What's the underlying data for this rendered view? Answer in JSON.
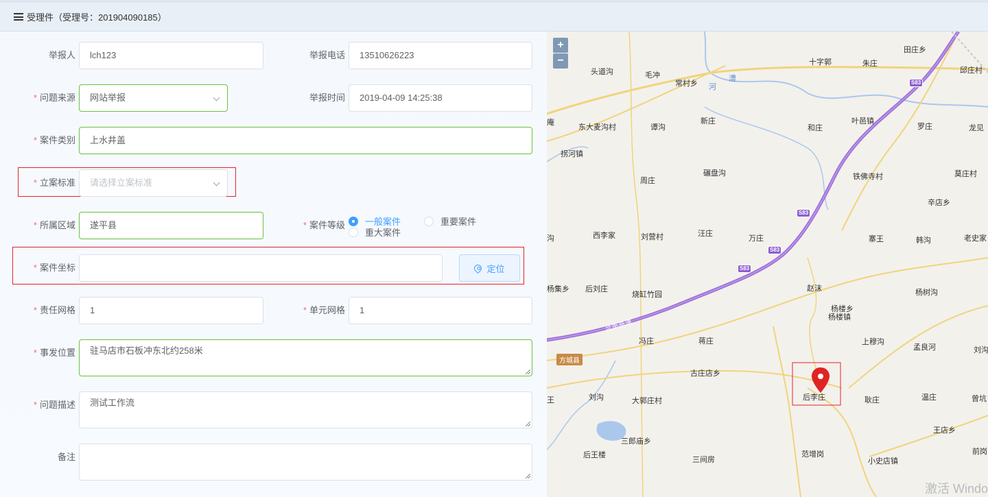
{
  "header": {
    "title": "受理件（受理号：201904090185）"
  },
  "form": {
    "reporter": {
      "label": "举报人",
      "value": "lch123"
    },
    "phone": {
      "label": "举报电话",
      "value": "13510626223"
    },
    "source": {
      "label": "问题来源",
      "value": "网站举报"
    },
    "report_time": {
      "label": "举报时间",
      "value": "2019-04-09 14:25:38"
    },
    "case_type": {
      "label": "案件类别",
      "value": "上水井盖"
    },
    "standard": {
      "label": "立案标准",
      "placeholder": "请选择立案标准"
    },
    "district": {
      "label": "所属区域",
      "value": "遂平县"
    },
    "level": {
      "label": "案件等级",
      "options": [
        "一般案件",
        "重要案件",
        "重大案件"
      ],
      "selected": "一般案件"
    },
    "coords": {
      "label": "案件坐标",
      "value": "",
      "locate_button": "定位"
    },
    "resp_grid": {
      "label": "责任网格",
      "value": "1"
    },
    "unit_grid": {
      "label": "单元网格",
      "value": "1"
    },
    "location": {
      "label": "事发位置",
      "value": "驻马店市石板冲东北约258米"
    },
    "description": {
      "label": "问题描述",
      "value": "测试工作流"
    },
    "remarks": {
      "label": "备注",
      "value": ""
    }
  },
  "map": {
    "zoom_in": "+",
    "zoom_out": "−",
    "places": [
      "田庄乡",
      "十字郭",
      "朱庄",
      "邱庄村",
      "头道沟",
      "毛冲",
      "常村乡",
      "河",
      "澧",
      "庵",
      "东大麦沟村",
      "谭沟",
      "新庄",
      "和庄",
      "叶邑镇",
      "罗庄",
      "龙见",
      "拐河镇",
      "碾盘沟",
      "周庄",
      "铁佛寺村",
      "莫庄村",
      "辛店乡",
      "沟",
      "西李家",
      "刘营村",
      "汪庄",
      "万庄",
      "寨王",
      "韩沟",
      "老史家",
      "杨集乡",
      "后刘庄",
      "烧缸竹园",
      "赵沫",
      "杨楼乡",
      "杨楼镇",
      "杨树沟",
      "冯庄",
      "蒋庄",
      "上穆沟",
      "孟良河",
      "刘沟",
      "方城县",
      "古庄店乡",
      "后李庄",
      "王",
      "刘沟",
      "大郭庄村",
      "耿庄",
      "温庄",
      "曾坑",
      "王店乡",
      "三郎庙乡",
      "后王楼",
      "三间房",
      "范增岗",
      "小史店镇",
      "前岗"
    ],
    "highway_labels": [
      "S83",
      "S83",
      "S83",
      "S83",
      "S83"
    ],
    "expressway_name": "兰南高速",
    "watermark": "激活 Windo"
  }
}
